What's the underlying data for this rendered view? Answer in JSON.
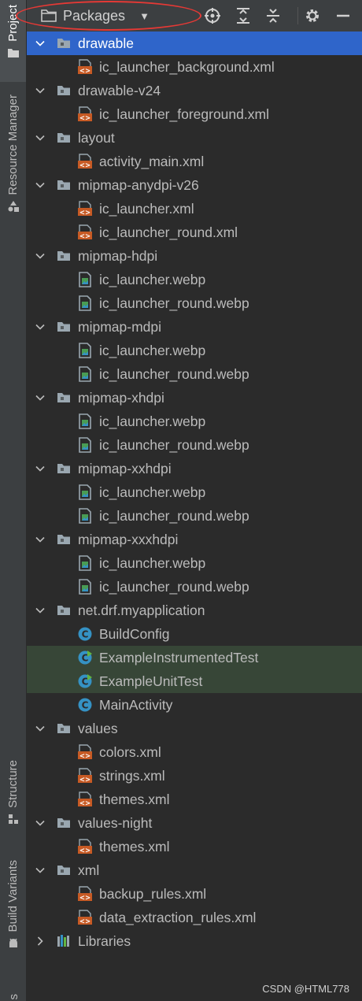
{
  "sidebar": {
    "project_label": "Project",
    "resource_manager_label": "Resource Manager",
    "structure_label": "Structure",
    "build_variants_label": "Build Variants"
  },
  "toolbar": {
    "view_selector_label": "Packages",
    "locate_icon": "crosshair-icon",
    "expand_all_icon": "expand-all-icon",
    "collapse_all_icon": "collapse-all-icon",
    "settings_icon": "gear-icon",
    "hide_icon": "minus-icon"
  },
  "tree": [
    {
      "label": "drawable",
      "type": "folder",
      "level": 0,
      "expanded": true,
      "selected": true
    },
    {
      "label": "ic_launcher_background.xml",
      "type": "xml",
      "level": 1
    },
    {
      "label": "drawable-v24",
      "type": "folder",
      "level": 0,
      "expanded": true
    },
    {
      "label": "ic_launcher_foreground.xml",
      "type": "xml",
      "level": 1
    },
    {
      "label": "layout",
      "type": "folder",
      "level": 0,
      "expanded": true
    },
    {
      "label": "activity_main.xml",
      "type": "xml",
      "level": 1
    },
    {
      "label": "mipmap-anydpi-v26",
      "type": "folder",
      "level": 0,
      "expanded": true
    },
    {
      "label": "ic_launcher.xml",
      "type": "xml",
      "level": 1
    },
    {
      "label": "ic_launcher_round.xml",
      "type": "xml",
      "level": 1
    },
    {
      "label": "mipmap-hdpi",
      "type": "folder",
      "level": 0,
      "expanded": true
    },
    {
      "label": "ic_launcher.webp",
      "type": "image",
      "level": 1
    },
    {
      "label": "ic_launcher_round.webp",
      "type": "image",
      "level": 1
    },
    {
      "label": "mipmap-mdpi",
      "type": "folder",
      "level": 0,
      "expanded": true
    },
    {
      "label": "ic_launcher.webp",
      "type": "image",
      "level": 1
    },
    {
      "label": "ic_launcher_round.webp",
      "type": "image",
      "level": 1
    },
    {
      "label": "mipmap-xhdpi",
      "type": "folder",
      "level": 0,
      "expanded": true
    },
    {
      "label": "ic_launcher.webp",
      "type": "image",
      "level": 1
    },
    {
      "label": "ic_launcher_round.webp",
      "type": "image",
      "level": 1
    },
    {
      "label": "mipmap-xxhdpi",
      "type": "folder",
      "level": 0,
      "expanded": true
    },
    {
      "label": "ic_launcher.webp",
      "type": "image",
      "level": 1
    },
    {
      "label": "ic_launcher_round.webp",
      "type": "image",
      "level": 1
    },
    {
      "label": "mipmap-xxxhdpi",
      "type": "folder",
      "level": 0,
      "expanded": true
    },
    {
      "label": "ic_launcher.webp",
      "type": "image",
      "level": 1
    },
    {
      "label": "ic_launcher_round.webp",
      "type": "image",
      "level": 1
    },
    {
      "label": "net.drf.myapplication",
      "type": "folder",
      "level": 0,
      "expanded": true
    },
    {
      "label": "BuildConfig",
      "type": "class",
      "level": 1
    },
    {
      "label": "ExampleInstrumentedTest",
      "type": "testclass",
      "level": 1,
      "highlighted": true
    },
    {
      "label": "ExampleUnitTest",
      "type": "testclass",
      "level": 1,
      "highlighted": true
    },
    {
      "label": "MainActivity",
      "type": "class",
      "level": 1
    },
    {
      "label": "values",
      "type": "folder",
      "level": 0,
      "expanded": true
    },
    {
      "label": "colors.xml",
      "type": "xml",
      "level": 1
    },
    {
      "label": "strings.xml",
      "type": "xml",
      "level": 1
    },
    {
      "label": "themes.xml",
      "type": "xml",
      "level": 1
    },
    {
      "label": "values-night",
      "type": "folder",
      "level": 0,
      "expanded": true
    },
    {
      "label": "themes.xml",
      "type": "xml",
      "level": 1
    },
    {
      "label": "xml",
      "type": "folder",
      "level": 0,
      "expanded": true
    },
    {
      "label": "backup_rules.xml",
      "type": "xml",
      "level": 1
    },
    {
      "label": "data_extraction_rules.xml",
      "type": "xml",
      "level": 1
    },
    {
      "label": "Libraries",
      "type": "libraries",
      "level": 0,
      "expanded": false
    }
  ],
  "watermark": "CSDN @HTML778",
  "colors": {
    "selection": "#2f65ca",
    "test_highlight": "#374637",
    "xml_icon": "#c75a24",
    "class_icon": "#3592c4",
    "annotation_ring": "#e53935"
  }
}
